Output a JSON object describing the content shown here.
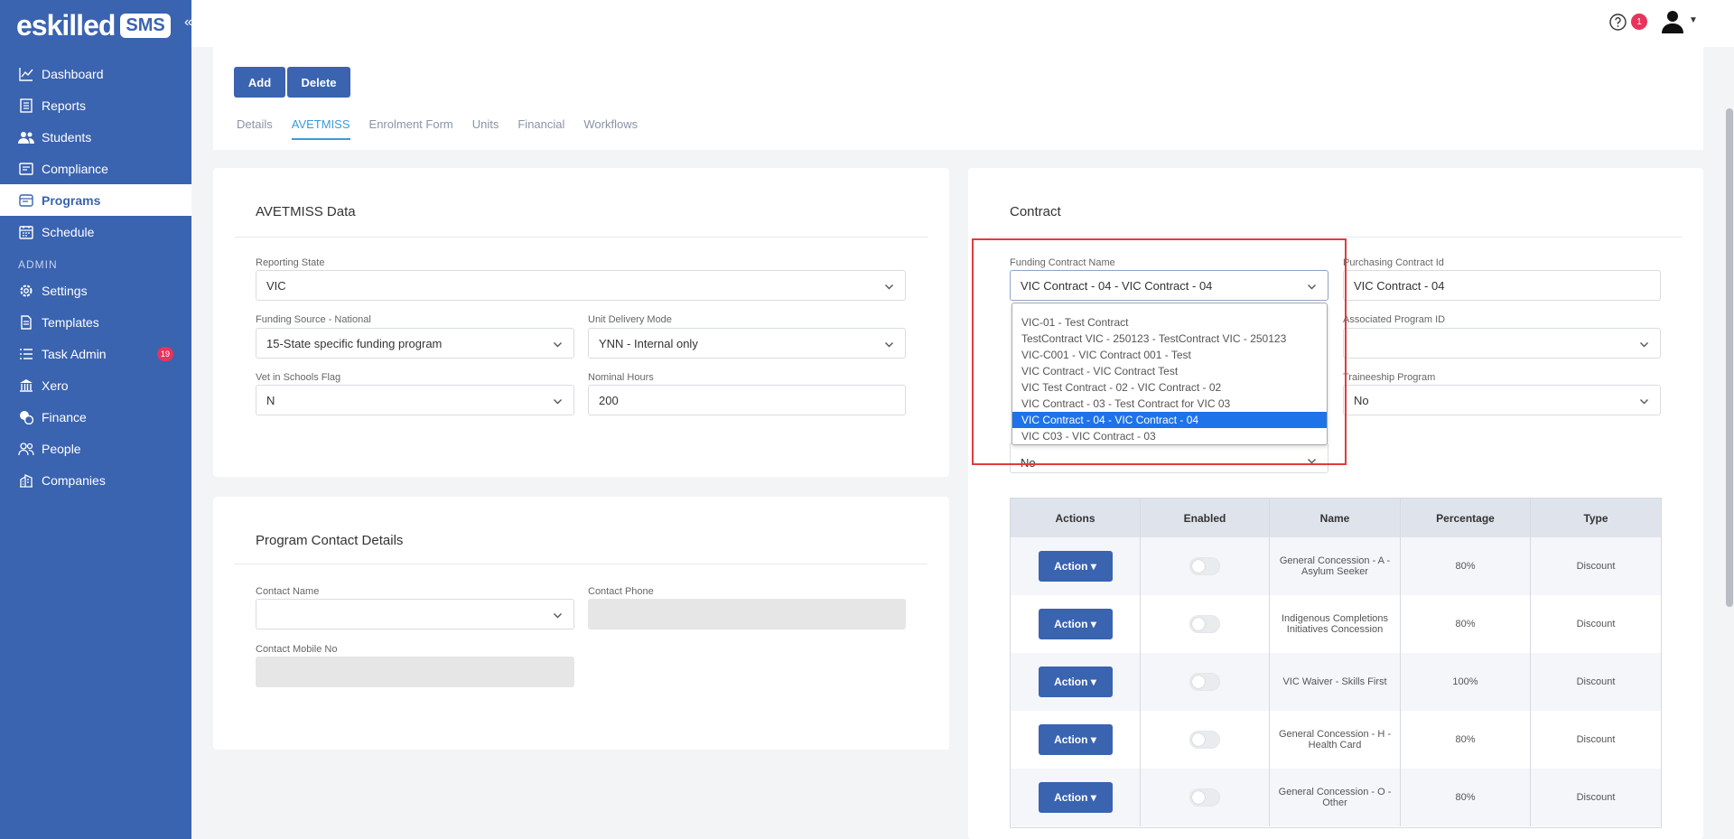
{
  "brand": {
    "name": "eskilled",
    "badge": "SMS"
  },
  "header": {
    "notifications": "1"
  },
  "sidebar": {
    "items": [
      {
        "label": "Dashboard",
        "icon": "chart-line-icon"
      },
      {
        "label": "Reports",
        "icon": "report-icon"
      },
      {
        "label": "Students",
        "icon": "users-icon"
      },
      {
        "label": "Compliance",
        "icon": "compliance-icon"
      },
      {
        "label": "Programs",
        "icon": "programs-icon",
        "active": true
      },
      {
        "label": "Schedule",
        "icon": "calendar-icon"
      }
    ],
    "admin_label": "ADMIN",
    "admin_items": [
      {
        "label": "Settings",
        "icon": "gear-icon"
      },
      {
        "label": "Templates",
        "icon": "document-icon"
      },
      {
        "label": "Task Admin",
        "icon": "list-icon",
        "badge": "19"
      },
      {
        "label": "Xero",
        "icon": "bank-icon"
      },
      {
        "label": "Finance",
        "icon": "coins-icon"
      },
      {
        "label": "People",
        "icon": "people-icon"
      },
      {
        "label": "Companies",
        "icon": "building-icon"
      }
    ]
  },
  "toolbar": {
    "add_label": "Add",
    "delete_label": "Delete"
  },
  "tabs": [
    {
      "label": "Details"
    },
    {
      "label": "AVETMISS",
      "active": true
    },
    {
      "label": "Enrolment Form"
    },
    {
      "label": "Units"
    },
    {
      "label": "Financial"
    },
    {
      "label": "Workflows"
    }
  ],
  "avetmiss": {
    "title": "AVETMISS Data",
    "reporting_state_label": "Reporting State",
    "reporting_state_value": "VIC",
    "funding_source_label": "Funding Source - National",
    "funding_source_value": "15-State specific funding program",
    "unit_delivery_label": "Unit Delivery Mode",
    "unit_delivery_value": "YNN - Internal only",
    "vet_flag_label": "Vet in Schools Flag",
    "vet_flag_value": "N",
    "nominal_hours_label": "Nominal Hours",
    "nominal_hours_value": "200"
  },
  "contact": {
    "title": "Program Contact Details",
    "name_label": "Contact Name",
    "phone_label": "Contact Phone",
    "mobile_label": "Contact Mobile No"
  },
  "contract": {
    "title": "Contract",
    "funding_label": "Funding Contract Name",
    "funding_value": "VIC Contract - 04 - VIC Contract - 04",
    "purchasing_label": "Purchasing Contract Id",
    "purchasing_value": "VIC Contract - 04",
    "associated_label": "Associated Program ID",
    "associated_value": "",
    "traineeship_label": "Traineeship Program",
    "traineeship_value": "No",
    "hidden_field_value": "No",
    "dropdown_options": [
      "VIC-01 - Test Contract",
      "TestContract VIC - 250123 - TestContract VIC - 250123",
      "VIC-C001 - VIC Contract 001 - Test",
      "VIC Contract - VIC Contract Test",
      "VIC Test Contract - 02 - VIC Contract - 02",
      "VIC Contract - 03 - Test Contract for VIC 03",
      "VIC Contract - 04 - VIC Contract - 04",
      "VIC C03 - VIC Contract - 03"
    ],
    "selected_index": 6
  },
  "concessions": {
    "headers": [
      "Actions",
      "Enabled",
      "Name",
      "Percentage",
      "Type"
    ],
    "action_label": "Action",
    "rows": [
      {
        "name": "General Concession - A - Asylum Seeker",
        "percentage": "80%",
        "type": "Discount"
      },
      {
        "name": "Indigenous Completions Initiatives Concession",
        "percentage": "80%",
        "type": "Discount"
      },
      {
        "name": "VIC Waiver - Skills First",
        "percentage": "100%",
        "type": "Discount"
      },
      {
        "name": "General Concession - H - Health Card",
        "percentage": "80%",
        "type": "Discount"
      },
      {
        "name": "General Concession - O - Other",
        "percentage": "80%",
        "type": "Discount"
      }
    ]
  }
}
